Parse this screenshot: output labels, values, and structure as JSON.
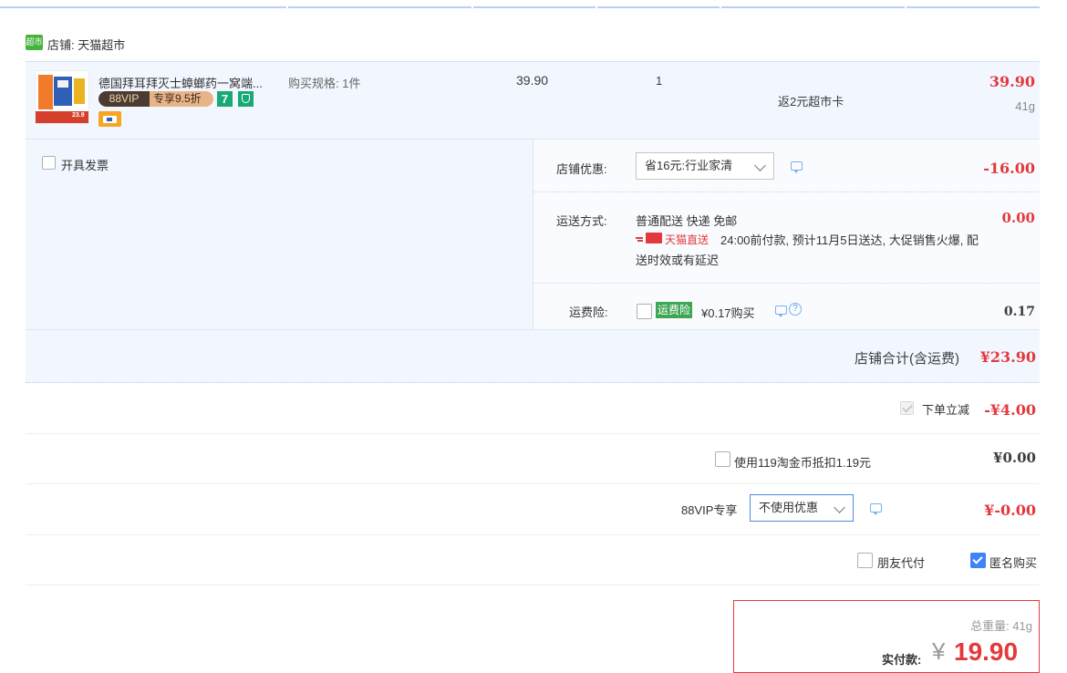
{
  "shop": {
    "badge": "超市",
    "label": "店铺: 天猫超市"
  },
  "item": {
    "title": "德国拜耳拜灭士蟑螂药一窝端...",
    "spec": "购买规格: 1件",
    "price": "39.90",
    "qty": "1",
    "service": "返2元超市卡",
    "subtotal": "39.90",
    "weight": "41g",
    "vip_badge": "88VIP",
    "vip_discount": "专享9.5折",
    "tag_seven": "7",
    "thumb_price": "23.9"
  },
  "invoice": {
    "label": "开具发票"
  },
  "shop_discount": {
    "label": "店铺优惠:",
    "selected": "省16元:行业家清",
    "amount": "-16.00"
  },
  "shipping": {
    "label": "运送方式:",
    "method": "普通配送 快递 免邮",
    "amount": "0.00",
    "direct_badge": "天猫直送",
    "note_line1": "24:00前付款, 预计11月5日送达, 大促销售火爆, 配",
    "note_line2": "送时效或有延迟"
  },
  "freight_insurance": {
    "label": "运费险:",
    "tag": "运费险",
    "price_text": "¥0.17购买",
    "help": "?",
    "amount": "0.17"
  },
  "shop_total": {
    "label": "店铺合计(含运费)",
    "amount": "¥23.90"
  },
  "order_discount": {
    "label": "下单立减",
    "amount": "-¥4.00"
  },
  "taobao_coins": {
    "label": "使用119淘金币抵扣1.19元",
    "amount": "¥0.00"
  },
  "vip": {
    "label": "88VIP专享",
    "selected": "不使用优惠",
    "amount": "¥-0.00"
  },
  "friend_pay": {
    "label": "朋友代付"
  },
  "anonymous": {
    "label": "匿名购买"
  },
  "summary": {
    "weight_label": "总重量: 41g",
    "pay_label": "实付款:",
    "currency": "¥",
    "pay_amount": "19.90"
  },
  "colors": {
    "accent_red": "#e4393c",
    "panel_bg": "#f2f7ff",
    "blue_check": "#3d84f6",
    "tmall_green": "#48b33f",
    "pay_box_border": "#e4393c"
  }
}
